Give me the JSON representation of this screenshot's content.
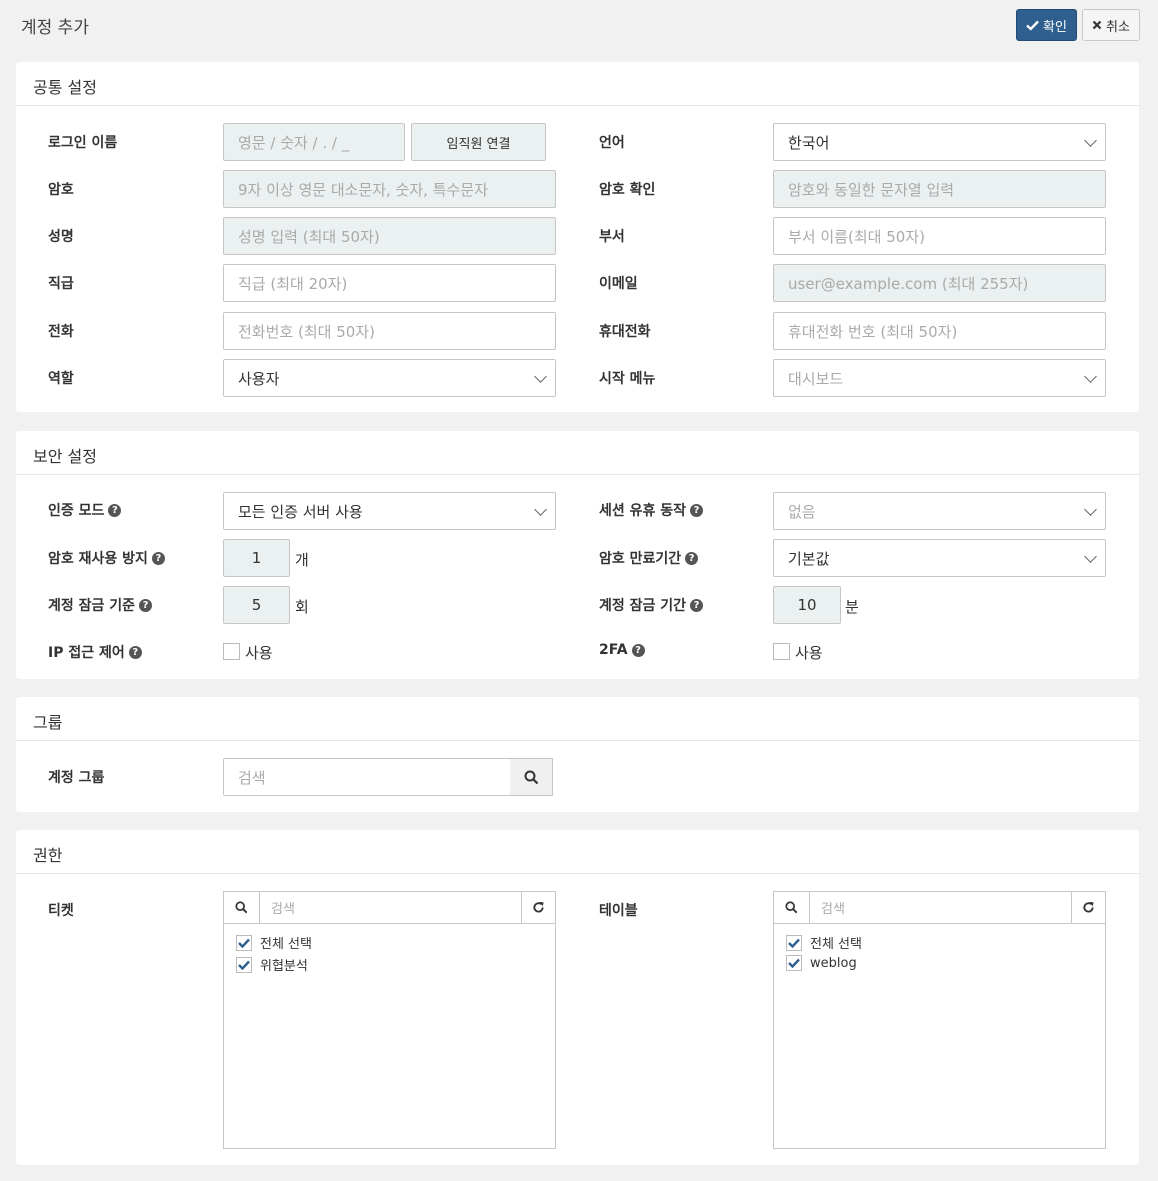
{
  "header": {
    "title": "계정 추가",
    "confirm_label": "확인",
    "cancel_label": "취소"
  },
  "common": {
    "title": "공통 설정",
    "login_label": "로그인 이름",
    "login_placeholder": "영문 / 숫자 / . / _",
    "employee_link": "임직원 연결",
    "lang_label": "언어",
    "lang_value": "한국어",
    "pw_label": "암호",
    "pw_placeholder": "9자 이상 영문 대소문자, 숫자, 특수문자",
    "pwc_label": "암호 확인",
    "pwc_placeholder": "암호와 동일한 문자열 입력",
    "name_label": "성명",
    "name_placeholder": "성명 입력 (최대 50자)",
    "dept_label": "부서",
    "dept_placeholder": "부서 이름(최대 50자)",
    "title_label": "직급",
    "title_placeholder": "직급 (최대 20자)",
    "email_label": "이메일",
    "email_placeholder": "user@example.com (최대 255자)",
    "phone_label": "전화",
    "phone_placeholder": "전화번호 (최대 50자)",
    "mobile_label": "휴대전화",
    "mobile_placeholder": "휴대전화 번호 (최대 50자)",
    "role_label": "역할",
    "role_value": "사용자",
    "startmenu_label": "시작 메뉴",
    "startmenu_value": "대시보드"
  },
  "security": {
    "title": "보안 설정",
    "auth_label": "인증 모드",
    "auth_value": "모든 인증 서버 사용",
    "idle_label": "세션 유휴 동작",
    "idle_value": "없음",
    "reuse_label": "암호 재사용 방지",
    "reuse_value": "1",
    "reuse_unit": "개",
    "expire_label": "암호 만료기간",
    "expire_value": "기본값",
    "lock_label": "계정 잠금 기준",
    "lock_value": "5",
    "lock_unit": "회",
    "lockdur_label": "계정 잠금 기간",
    "lockdur_value": "10",
    "lockdur_unit": "분",
    "ip_label": "IP 접근 제어",
    "ip_check": "사용",
    "twofa_label": "2FA",
    "twofa_check": "사용"
  },
  "group": {
    "title": "그룹",
    "label": "계정 그룹",
    "search_placeholder": "검색"
  },
  "perm": {
    "title": "권한",
    "ticket_label": "티켓",
    "ticket_search": "검색",
    "ticket_items": [
      "전체 선택",
      "위협분석"
    ],
    "table_label": "테이블",
    "table_search": "검색",
    "table_items": [
      "전체 선택",
      "weblog"
    ]
  },
  "colors": {
    "primary": "#2f5f8f",
    "check": "#2f5f8f",
    "required_bg": "#ebf0f1"
  }
}
